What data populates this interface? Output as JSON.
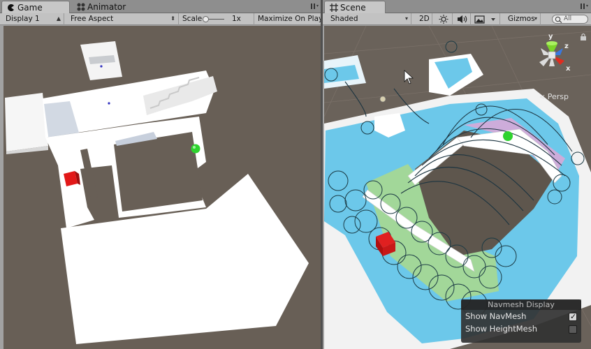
{
  "game": {
    "tab_label": "Game",
    "animator_tab_label": "Animator",
    "display": "Display 1",
    "aspect": "Free Aspect",
    "scale_label": "Scale",
    "scale_value": "1x",
    "maximize_label": "Maximize On Play"
  },
  "scene": {
    "tab_label": "Scene",
    "shading_mode": "Shaded",
    "toggle_2d": "2D",
    "gizmos_label": "Gizmos",
    "search_placeholder": "All",
    "projection_label": "Persp",
    "axis_labels": {
      "x": "x",
      "y": "y",
      "z": "z"
    }
  },
  "navmesh_display": {
    "title": "Navmesh Display",
    "show_navmesh_label": "Show NavMesh",
    "show_navmesh_checked": true,
    "show_heightmesh_label": "Show HeightMesh",
    "show_heightmesh_checked": false
  },
  "colors": {
    "editor_bg": "#a2a2a2",
    "viewport_bg": "#685f56",
    "navmesh_blue": "#6cc8ea",
    "navmesh_green": "#a8d890",
    "navmesh_pink": "#d8a8d8",
    "player_red": "#e02020",
    "target_green": "#30d030"
  }
}
